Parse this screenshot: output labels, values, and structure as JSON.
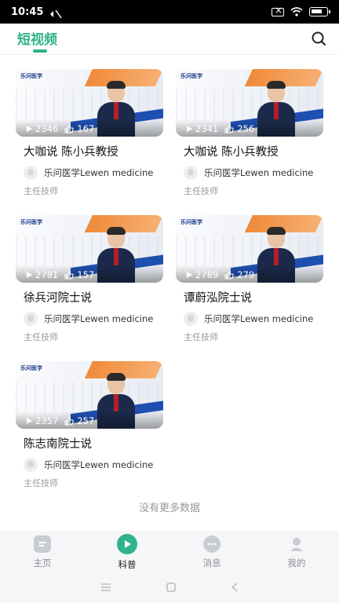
{
  "status_bar": {
    "time": "10:45"
  },
  "header": {
    "title": "短视频"
  },
  "videos": [
    {
      "views": "2346",
      "likes": "167",
      "title": "大咖说 陈小兵教授",
      "author": "乐问医学Lewen medicine",
      "role": "主任技师"
    },
    {
      "views": "2341",
      "likes": "256",
      "title": "大咖说 陈小兵教授",
      "author": "乐问医学Lewen medicine",
      "role": "主任技师"
    },
    {
      "views": "2781",
      "likes": "157",
      "title": "徐兵河院士说",
      "author": "乐问医学Lewen medicine",
      "role": "主任技师"
    },
    {
      "views": "2789",
      "likes": "279",
      "title": "谭蔚泓院士说",
      "author": "乐问医学Lewen medicine",
      "role": "主任技师"
    },
    {
      "views": "2357",
      "likes": "257",
      "title": "陈志南院士说",
      "author": "乐问医学Lewen medicine",
      "role": "主任技师"
    }
  ],
  "footer_text": "没有更多数据",
  "tabs": [
    {
      "label": "主页",
      "icon": "home-icon",
      "active": false
    },
    {
      "label": "科普",
      "icon": "play-circle-icon",
      "active": true
    },
    {
      "label": "消息",
      "icon": "chat-icon",
      "active": false
    },
    {
      "label": "我的",
      "icon": "user-icon",
      "active": false
    }
  ],
  "colors": {
    "accent": "#2fb38a",
    "thumb_orange": "#f08a3a",
    "thumb_blue": "#1f4fb0"
  }
}
